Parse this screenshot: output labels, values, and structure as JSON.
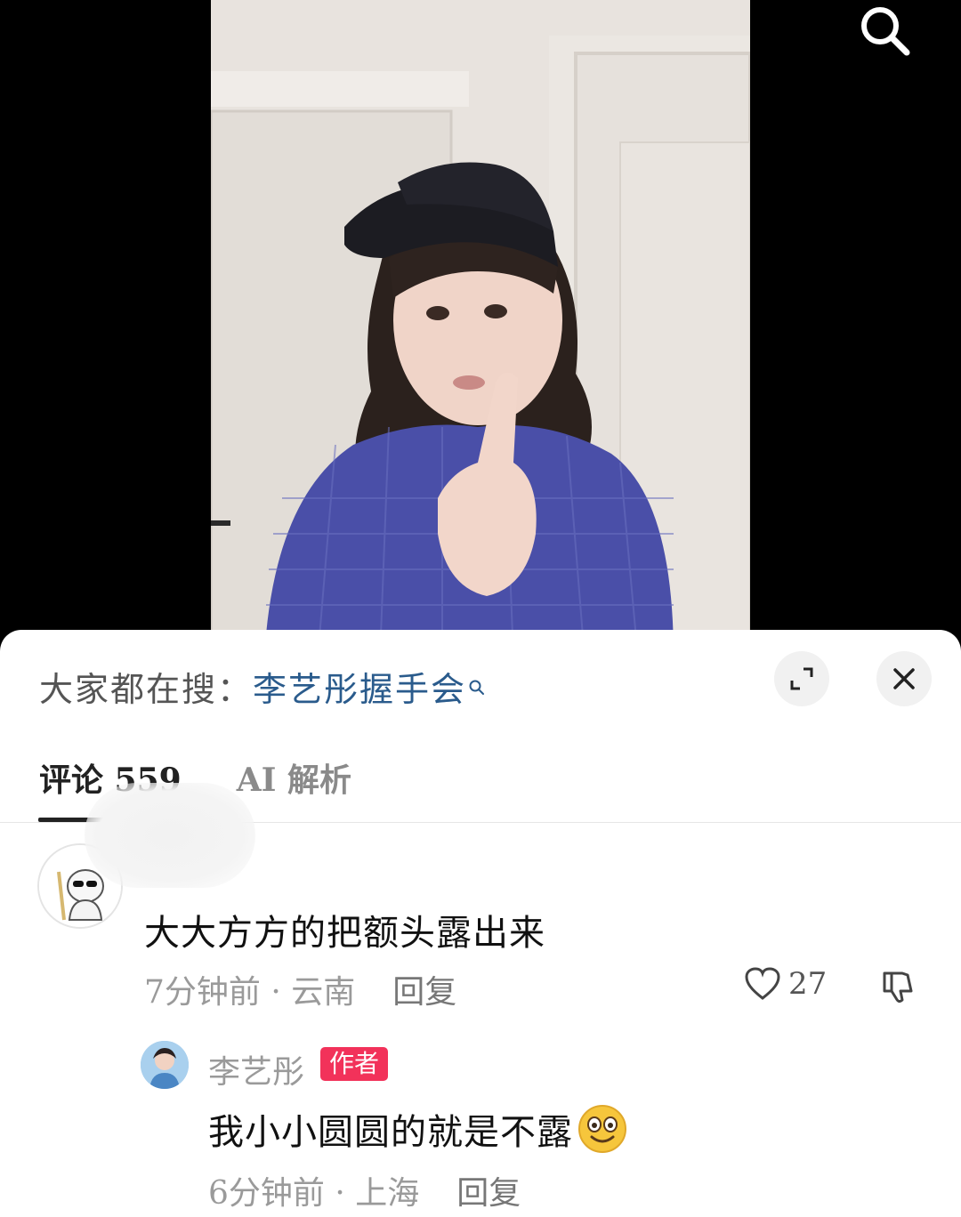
{
  "header": {
    "search_icon": "search-icon"
  },
  "hot_search": {
    "prefix": "大家都在搜：",
    "keyword": "李艺彤握手会",
    "keyword_icon": "search-icon",
    "expand_icon": "expand-icon",
    "close_icon": "close-icon"
  },
  "tabs": [
    {
      "label": "评论 559",
      "active": true
    },
    {
      "label": "AI 解析",
      "active": false
    }
  ],
  "comments": [
    {
      "avatar": "cartoon-avatar",
      "text": "大大方方的把额头露出来",
      "time": "7分钟前",
      "location": "云南",
      "meta_separator": " · ",
      "reply_label": "回复",
      "likes": "27",
      "like_icon": "heart-icon",
      "dislike_icon": "thumbs-down-icon"
    },
    {
      "avatar": "user-avatar",
      "username": "李艺彤",
      "badge": "作者",
      "text": "我小小圆圆的就是不露",
      "emoji": "smiling-emoji",
      "time": "6分钟前",
      "location": "上海",
      "meta_separator": " · ",
      "reply_label": "回复"
    }
  ],
  "colors": {
    "keyword": "#2a5b8c",
    "badge": "#f2325a",
    "muted_text": "#9a9a9a"
  }
}
